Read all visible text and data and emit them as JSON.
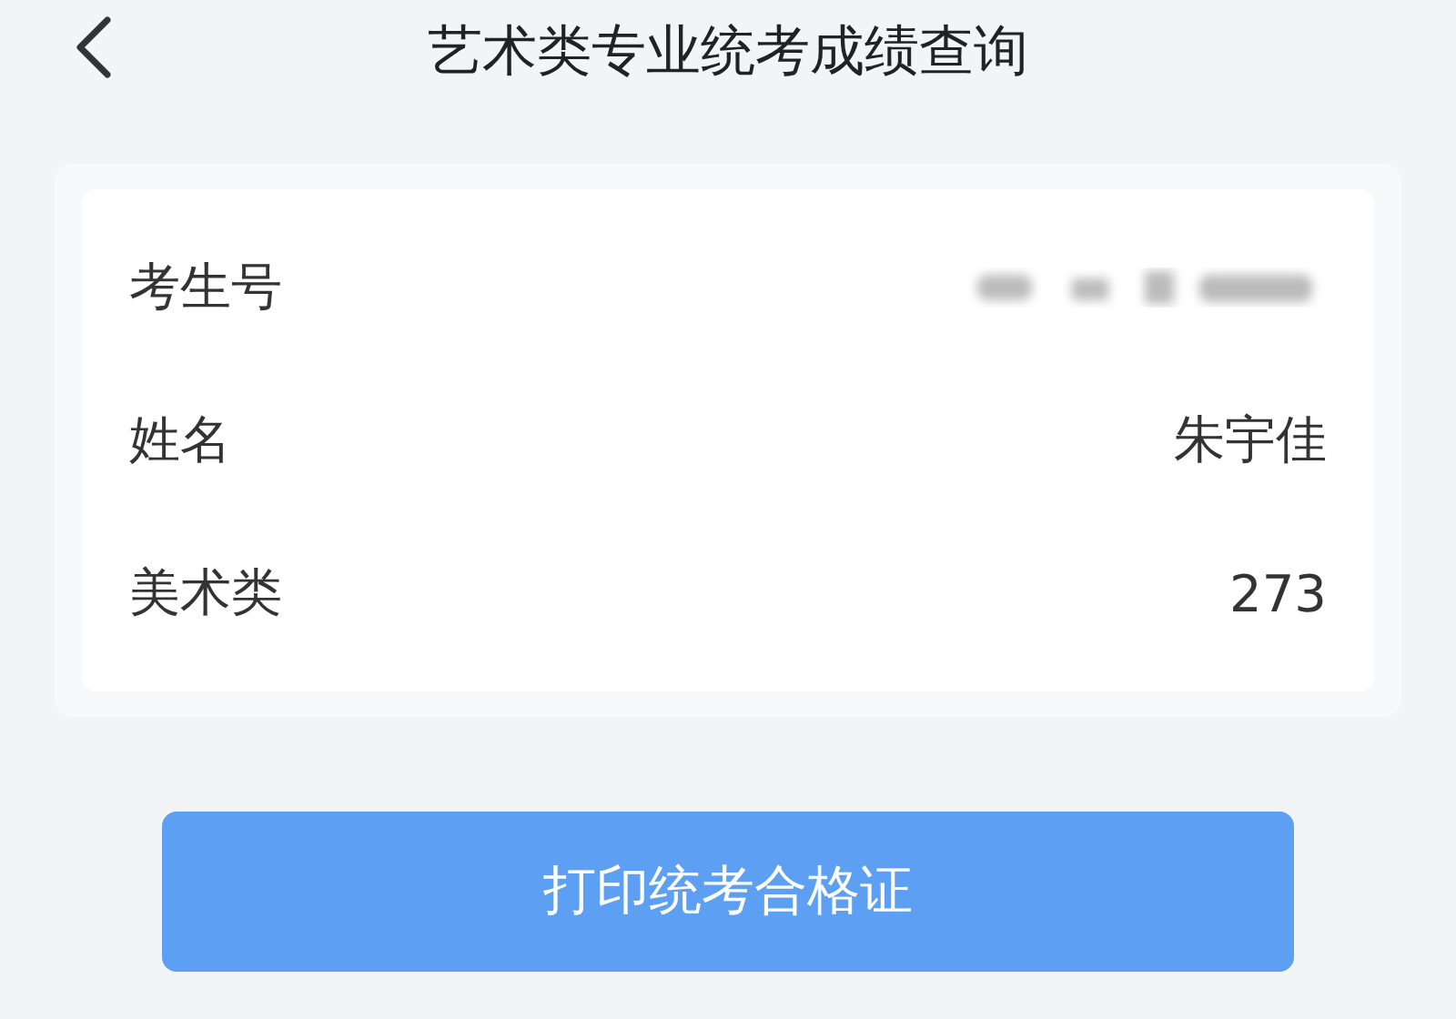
{
  "header": {
    "title": "艺术类专业统考成绩查询"
  },
  "rows": [
    {
      "label": "考生号",
      "kind": "redacted"
    },
    {
      "label": "姓名",
      "kind": "text",
      "value": "朱宇佳"
    },
    {
      "label": "美术类",
      "kind": "text",
      "value": "273"
    }
  ],
  "print_button": {
    "label": "打印统考合格证"
  }
}
